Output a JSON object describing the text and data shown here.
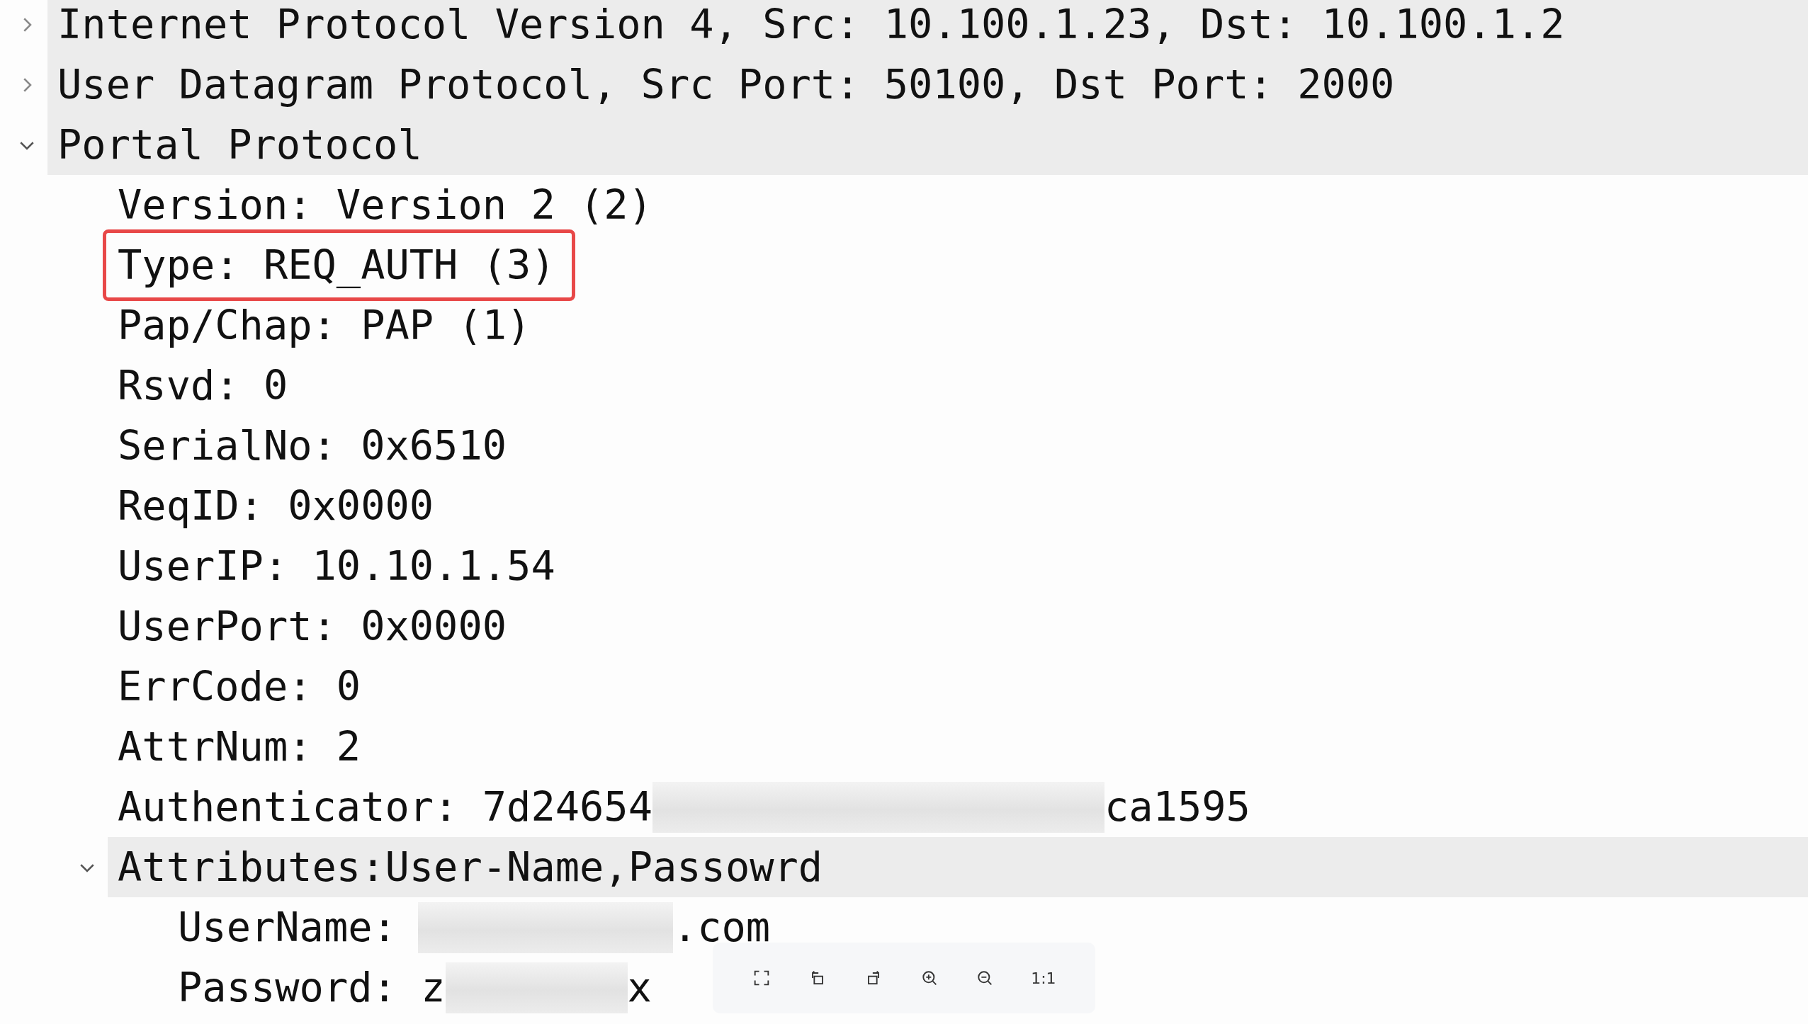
{
  "tree": [
    {
      "kind": "subtree",
      "expanded": false,
      "label": "Internet Protocol Version 4, Src: 10.100.1.23, Dst: 10.100.1.2"
    },
    {
      "kind": "subtree",
      "expanded": false,
      "label": "User Datagram Protocol, Src Port: 50100, Dst Port: 2000"
    },
    {
      "kind": "subtree",
      "expanded": true,
      "label": "Portal Protocol",
      "children": [
        {
          "kind": "field",
          "label": "Version: Version 2 (2)",
          "highlighted": false
        },
        {
          "kind": "field",
          "label": "Type: REQ_AUTH (3)",
          "highlighted": true
        },
        {
          "kind": "field",
          "label": "Pap/Chap: PAP (1)",
          "highlighted": false
        },
        {
          "kind": "field",
          "label": "Rsvd: 0",
          "highlighted": false
        },
        {
          "kind": "field",
          "label": "SerialNo: 0x6510",
          "highlighted": false
        },
        {
          "kind": "field",
          "label": "ReqID: 0x0000",
          "highlighted": false
        },
        {
          "kind": "field",
          "label": "UserIP: 10.10.1.54",
          "highlighted": false
        },
        {
          "kind": "field",
          "label": "UserPort: 0x0000",
          "highlighted": false
        },
        {
          "kind": "field",
          "label": "ErrCode: 0",
          "highlighted": false
        },
        {
          "kind": "field",
          "label": "AttrNum: 2",
          "highlighted": false
        },
        {
          "kind": "redacted",
          "parts": [
            {
              "kind": "text",
              "text": "Authenticator: 7d24654"
            },
            {
              "kind": "blur-long"
            },
            {
              "kind": "text",
              "text": "ca1595"
            }
          ]
        },
        {
          "kind": "subtree",
          "expanded": true,
          "label": "Attributes:User-Name,Passowrd",
          "children": [
            {
              "kind": "redacted",
              "parts": [
                {
                  "kind": "text",
                  "text": "UserName:"
                },
                {
                  "kind": "blur-medium"
                },
                {
                  "kind": "text",
                  "text": ".com"
                }
              ]
            },
            {
              "kind": "redacted",
              "parts": [
                {
                  "kind": "text",
                  "text": "Password: z"
                },
                {
                  "kind": "blur-short"
                },
                {
                  "kind": "text",
                  "text": "x"
                }
              ]
            }
          ]
        }
      ]
    }
  ],
  "viewer_toolbar": [
    {
      "kind": "fullscreen"
    },
    {
      "kind": "rotate-left"
    },
    {
      "kind": "rotate-right"
    },
    {
      "kind": "zoom-in"
    },
    {
      "kind": "zoom-out"
    },
    {
      "kind": "actual-size",
      "label": "1:1"
    }
  ]
}
